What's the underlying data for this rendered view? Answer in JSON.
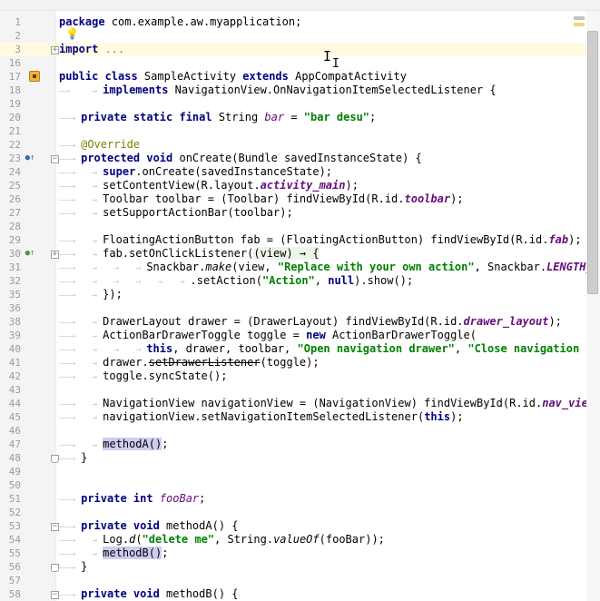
{
  "lines": [
    {
      "no": "1",
      "text": [
        {
          "c": "kw",
          "t": "package"
        },
        {
          "t": " com.example.aw.myapplication;"
        }
      ]
    },
    {
      "no": "2",
      "text": []
    },
    {
      "no": "3",
      "caret": true,
      "fold": "+",
      "text": [
        {
          "c": "kw",
          "t": "import"
        },
        {
          "c": "gray",
          "t": " ..."
        }
      ]
    },
    {
      "no": "16",
      "text": []
    },
    {
      "no": "17",
      "icon": "run",
      "text": [
        {
          "c": "kw",
          "t": "public class"
        },
        {
          "t": " SampleActivity "
        },
        {
          "c": "kw",
          "t": "extends"
        },
        {
          "t": " AppCompatActivity"
        }
      ]
    },
    {
      "no": "18",
      "text": [
        {
          "c": "tab",
          "t": "—→    → "
        },
        {
          "c": "kw",
          "t": "implements"
        },
        {
          "t": " NavigationView.OnNavigationItemSelectedListener {"
        }
      ]
    },
    {
      "no": "19",
      "text": []
    },
    {
      "no": "20",
      "text": [
        {
          "c": "tab",
          "t": "——→ "
        },
        {
          "c": "kw",
          "t": "private static final"
        },
        {
          "t": " String "
        },
        {
          "c": "fldi",
          "t": "bar"
        },
        {
          "t": " = "
        },
        {
          "c": "str",
          "t": "\"bar desu\""
        },
        {
          "t": ";"
        }
      ]
    },
    {
      "no": "21",
      "text": []
    },
    {
      "no": "22",
      "text": [
        {
          "c": "tab",
          "t": "——→ "
        },
        {
          "c": "ann",
          "t": "@Override"
        }
      ]
    },
    {
      "no": "23",
      "icon": "override",
      "fold": "-",
      "text": [
        {
          "c": "tab",
          "t": "——→ "
        },
        {
          "c": "kw",
          "t": "protected void"
        },
        {
          "t": " onCreate(Bundle savedInstanceState) {"
        }
      ]
    },
    {
      "no": "24",
      "text": [
        {
          "c": "tab",
          "t": "——→   → "
        },
        {
          "c": "kw",
          "t": "super"
        },
        {
          "t": ".onCreate(savedInstanceState);"
        }
      ]
    },
    {
      "no": "25",
      "text": [
        {
          "c": "tab",
          "t": "——→   → "
        },
        {
          "t": "setContentView(R.layout."
        },
        {
          "c": "fld",
          "t": "activity_main"
        },
        {
          "t": ");"
        }
      ]
    },
    {
      "no": "26",
      "text": [
        {
          "c": "tab",
          "t": "——→   → "
        },
        {
          "t": "Toolbar toolbar = (Toolbar) findViewById(R.id."
        },
        {
          "c": "fld",
          "t": "toolbar"
        },
        {
          "t": ");"
        }
      ]
    },
    {
      "no": "27",
      "text": [
        {
          "c": "tab",
          "t": "——→   → "
        },
        {
          "t": "setSupportActionBar(toolbar);"
        }
      ]
    },
    {
      "no": "28",
      "text": []
    },
    {
      "no": "29",
      "text": [
        {
          "c": "tab",
          "t": "——→   → "
        },
        {
          "t": "FloatingActionButton fab = (FloatingActionButton) findViewById(R.id."
        },
        {
          "c": "fld",
          "t": "fab"
        },
        {
          "t": ");"
        }
      ]
    },
    {
      "no": "30",
      "icon": "lambda",
      "fold": "+",
      "text": [
        {
          "c": "tab",
          "t": "——→   → "
        },
        {
          "t": "fab.setOnClickListener("
        },
        {
          "c": "lam",
          "t": "(view) → {"
        }
      ]
    },
    {
      "no": "31",
      "text": [
        {
          "c": "tab",
          "t": "——→   →   →   → "
        },
        {
          "t": "Snackbar."
        },
        {
          "c": "it",
          "t": "make"
        },
        {
          "t": "(view, "
        },
        {
          "c": "str",
          "t": "\"Replace with your own action\""
        },
        {
          "t": ", Snackbar."
        },
        {
          "c": "fld",
          "t": "LENGTH_"
        }
      ]
    },
    {
      "no": "32",
      "text": [
        {
          "c": "tab",
          "t": "——→   →   →   →   →   → "
        },
        {
          "t": ".setAction("
        },
        {
          "c": "str",
          "t": "\"Action\""
        },
        {
          "t": ", "
        },
        {
          "c": "kw",
          "t": "null"
        },
        {
          "t": ").show();"
        }
      ]
    },
    {
      "no": "35",
      "text": [
        {
          "c": "tab",
          "t": "——→   → "
        },
        {
          "t": "});"
        }
      ]
    },
    {
      "no": "36",
      "text": []
    },
    {
      "no": "38",
      "text": [
        {
          "c": "tab",
          "t": "——→   → "
        },
        {
          "t": "DrawerLayout drawer = (DrawerLayout) findViewById(R.id."
        },
        {
          "c": "fld",
          "t": "drawer_layout"
        },
        {
          "t": ");"
        }
      ]
    },
    {
      "no": "39",
      "text": [
        {
          "c": "tab",
          "t": "——→   → "
        },
        {
          "t": "ActionBarDrawerToggle toggle = "
        },
        {
          "c": "kw",
          "t": "new"
        },
        {
          "t": " ActionBarDrawerToggle("
        }
      ]
    },
    {
      "no": "40",
      "text": [
        {
          "c": "tab",
          "t": "——→   →   →   → "
        },
        {
          "c": "kw",
          "t": "this"
        },
        {
          "t": ", drawer, toolbar, "
        },
        {
          "c": "str",
          "t": "\"Open navigation drawer\""
        },
        {
          "t": ", "
        },
        {
          "c": "str",
          "t": "\"Close navigation "
        },
        {
          "c": "cutoff",
          "t": "d"
        }
      ]
    },
    {
      "no": "41",
      "text": [
        {
          "c": "tab",
          "t": "——→   → "
        },
        {
          "t": "drawer."
        },
        {
          "c": "strike",
          "t": "setDrawerListener"
        },
        {
          "t": "(toggle);"
        }
      ]
    },
    {
      "no": "42",
      "text": [
        {
          "c": "tab",
          "t": "——→   → "
        },
        {
          "t": "toggle.syncState();"
        }
      ]
    },
    {
      "no": "43",
      "text": []
    },
    {
      "no": "44",
      "text": [
        {
          "c": "tab",
          "t": "——→   → "
        },
        {
          "t": "NavigationView navigationView = (NavigationView) findViewById(R.id."
        },
        {
          "c": "fld",
          "t": "nav_view"
        },
        {
          "t": ")"
        }
      ]
    },
    {
      "no": "45",
      "text": [
        {
          "c": "tab",
          "t": "——→   → "
        },
        {
          "t": "navigationView.setNavigationItemSelectedListener("
        },
        {
          "c": "kw",
          "t": "this"
        },
        {
          "t": ");"
        }
      ]
    },
    {
      "no": "46",
      "text": []
    },
    {
      "no": "47",
      "text": [
        {
          "c": "tab",
          "t": "——→   → "
        },
        {
          "c": "hl",
          "t": "methodA()"
        },
        {
          "t": ";"
        }
      ]
    },
    {
      "no": "48",
      "fold": "end",
      "text": [
        {
          "c": "tab",
          "t": "——→ "
        },
        {
          "t": "}"
        }
      ]
    },
    {
      "no": "49",
      "text": []
    },
    {
      "no": "50",
      "text": []
    },
    {
      "no": "51",
      "text": [
        {
          "c": "tab",
          "t": "——→ "
        },
        {
          "c": "kw",
          "t": "private int"
        },
        {
          "t": " "
        },
        {
          "c": "fldi",
          "t": "fooBar"
        },
        {
          "t": ";"
        }
      ]
    },
    {
      "no": "52",
      "text": []
    },
    {
      "no": "53",
      "fold": "-",
      "text": [
        {
          "c": "tab",
          "t": "——→ "
        },
        {
          "c": "kw",
          "t": "private void"
        },
        {
          "t": " methodA() {"
        }
      ]
    },
    {
      "no": "54",
      "text": [
        {
          "c": "tab",
          "t": "——→   → "
        },
        {
          "t": "Log."
        },
        {
          "c": "it",
          "t": "d"
        },
        {
          "t": "("
        },
        {
          "c": "str",
          "t": "\"delete me\""
        },
        {
          "t": ", String."
        },
        {
          "c": "it",
          "t": "valueOf"
        },
        {
          "t": "(fooBar));"
        }
      ]
    },
    {
      "no": "55",
      "text": [
        {
          "c": "tab",
          "t": "——→   → "
        },
        {
          "c": "hl",
          "t": "methodB()"
        },
        {
          "t": ";"
        }
      ]
    },
    {
      "no": "56",
      "fold": "end",
      "text": [
        {
          "c": "tab",
          "t": "——→ "
        },
        {
          "t": "}"
        }
      ]
    },
    {
      "no": "57",
      "text": []
    },
    {
      "no": "58",
      "fold": "-",
      "text": [
        {
          "c": "tab",
          "t": "——→ "
        },
        {
          "c": "kw",
          "t": "private void"
        },
        {
          "t": " methodB() {"
        }
      ]
    }
  ],
  "gutter_icons": {
    "bulb": "intention-bulb-icon",
    "override": "override-method-icon",
    "lambda": "lambda-icon",
    "run": "run-class-icon"
  },
  "colors": {
    "keyword": "#000080",
    "string": "#008000",
    "field": "#660e7a",
    "annotation": "#808000",
    "usage_highlight": "#cccdf0",
    "caret_line": "#fffbe0"
  }
}
